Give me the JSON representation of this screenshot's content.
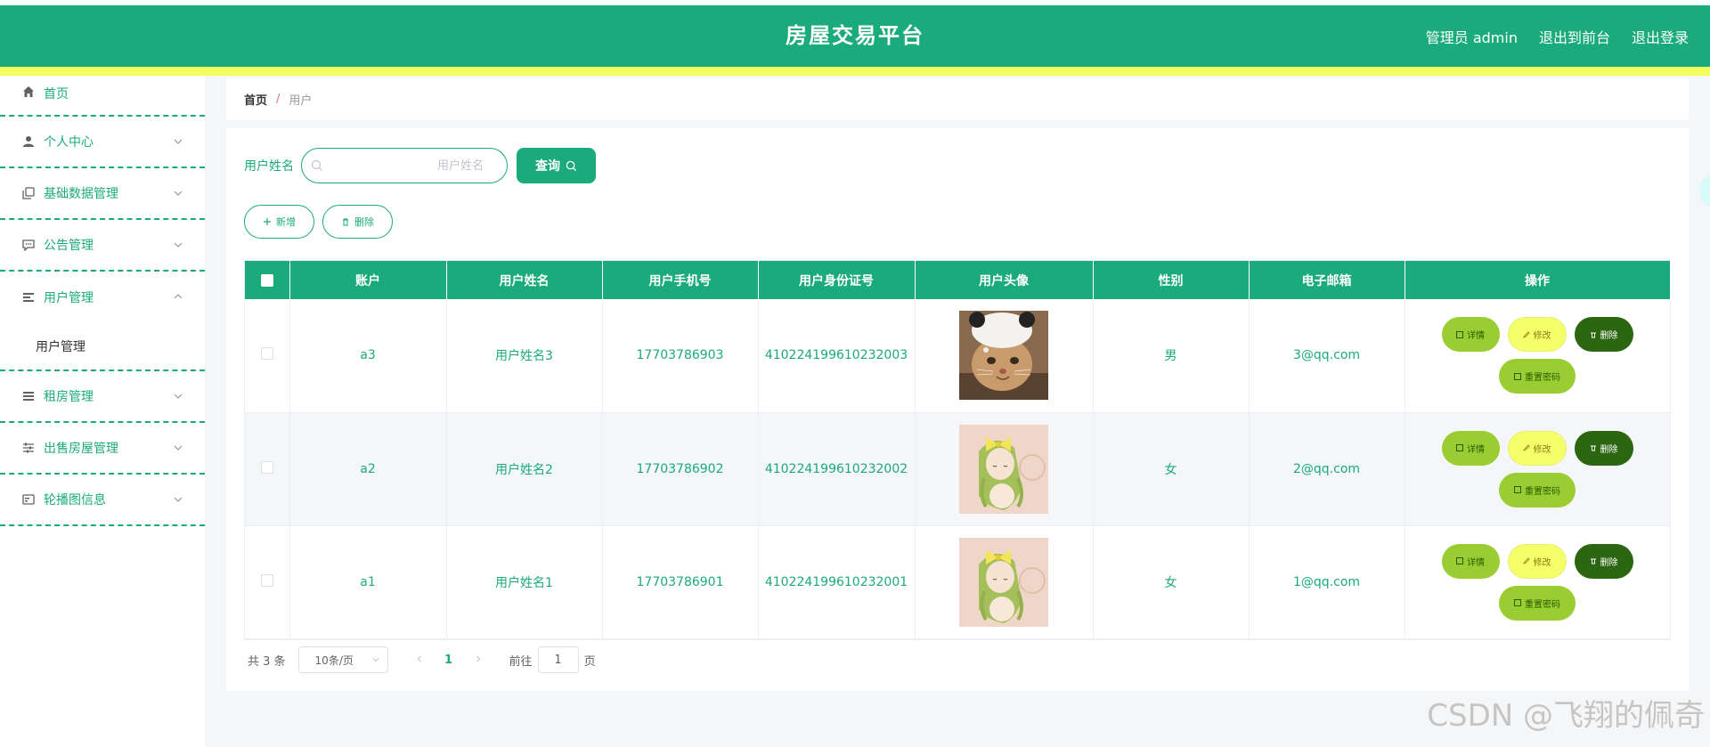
{
  "header": {
    "title": "房屋交易平台",
    "user_label": "管理员 admin",
    "front_link": "退出到前台",
    "logout_link": "退出登录",
    "bg_color": "#1baa7b",
    "bar_color": "#f3ff5e"
  },
  "sidebar": {
    "items": [
      {
        "label": "首页",
        "icon": "home-icon"
      },
      {
        "label": "个人中心",
        "icon": "user-icon"
      },
      {
        "label": "基础数据管理",
        "icon": "copy-icon"
      },
      {
        "label": "公告管理",
        "icon": "chat-icon"
      },
      {
        "label": "用户管理",
        "icon": "list-icon",
        "expanded": true,
        "children": [
          "用户管理"
        ]
      },
      {
        "label": "租房管理",
        "icon": "menu-icon"
      },
      {
        "label": "出售房屋管理",
        "icon": "sliders-icon"
      },
      {
        "label": "轮播图信息",
        "icon": "card-icon"
      }
    ]
  },
  "breadcrumb": {
    "home": "首页",
    "separator": "/",
    "current": "用户"
  },
  "search": {
    "label": "用户姓名",
    "placeholder": "用户姓名",
    "button": "查询"
  },
  "actions": {
    "add": "新增",
    "delete": "删除"
  },
  "table": {
    "columns": [
      "账户",
      "用户姓名",
      "用户手机号",
      "用户身份证号",
      "用户头像",
      "性别",
      "电子邮箱",
      "操作"
    ],
    "rows": [
      {
        "account": "a3",
        "name": "用户姓名3",
        "phone": "17703786903",
        "idcard": "410224199610232003",
        "avatar": "cat-photo",
        "gender": "男",
        "email": "3@qq.com"
      },
      {
        "account": "a2",
        "name": "用户姓名2",
        "phone": "17703786902",
        "idcard": "410224199610232002",
        "avatar": "anime-girl-illustration",
        "gender": "女",
        "email": "2@qq.com"
      },
      {
        "account": "a1",
        "name": "用户姓名1",
        "phone": "17703786901",
        "idcard": "410224199610232001",
        "avatar": "anime-girl-illustration",
        "gender": "女",
        "email": "1@qq.com"
      }
    ],
    "row_actions": {
      "detail": "详情",
      "edit": "修改",
      "delete": "删除",
      "reset": "重置密码"
    }
  },
  "pagination": {
    "total": "共 3 条",
    "page_size": "10条/页",
    "current_page": "1",
    "goto_label": "前往",
    "goto_value": "1",
    "page_suffix": "页"
  },
  "watermark": "CSDN @飞翔的佩奇"
}
